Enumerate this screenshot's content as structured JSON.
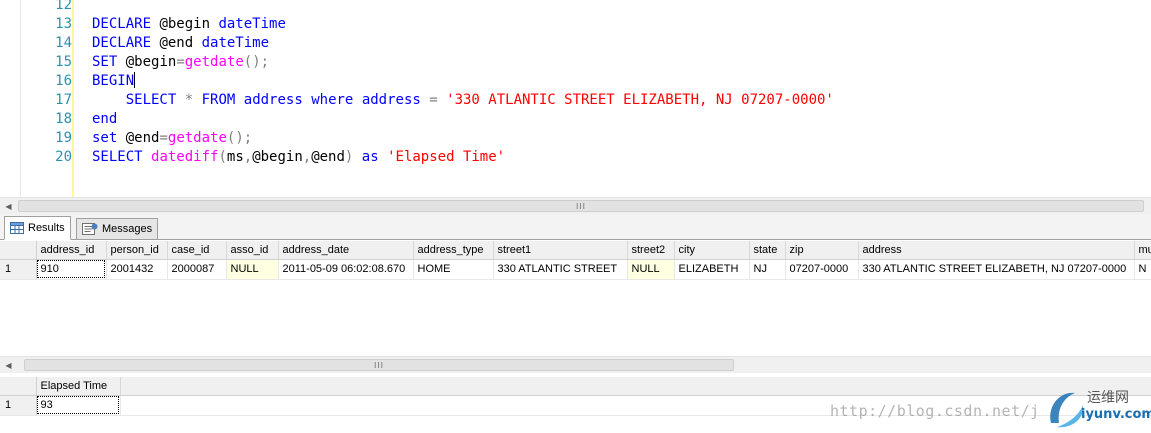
{
  "editor": {
    "line_numbers": [
      "12",
      "13",
      "14",
      "15",
      "16",
      "17",
      "18",
      "19",
      "20"
    ],
    "lines": [
      {
        "n": "12",
        "tokens": []
      },
      {
        "n": "13",
        "tokens": [
          {
            "t": "DECLARE",
            "c": "kw"
          },
          {
            "t": " @begin ",
            "c": "plain"
          },
          {
            "t": "dateTime",
            "c": "kw"
          }
        ]
      },
      {
        "n": "14",
        "tokens": [
          {
            "t": "DECLARE",
            "c": "kw"
          },
          {
            "t": " @end ",
            "c": "plain"
          },
          {
            "t": "dateTime",
            "c": "kw"
          }
        ]
      },
      {
        "n": "15",
        "tokens": [
          {
            "t": "SET",
            "c": "kw"
          },
          {
            "t": " @begin",
            "c": "plain"
          },
          {
            "t": "=",
            "c": "op"
          },
          {
            "t": "getdate",
            "c": "fn"
          },
          {
            "t": "();",
            "c": "op"
          }
        ]
      },
      {
        "n": "16",
        "tokens": [
          {
            "t": "BEGIN",
            "c": "kw"
          }
        ],
        "caret": true
      },
      {
        "n": "17",
        "tokens": [
          {
            "t": "    ",
            "c": "plain"
          },
          {
            "t": "SELECT",
            "c": "kw"
          },
          {
            "t": " ",
            "c": "plain"
          },
          {
            "t": "*",
            "c": "op"
          },
          {
            "t": " ",
            "c": "plain"
          },
          {
            "t": "FROM",
            "c": "kw"
          },
          {
            "t": " ",
            "c": "plain"
          },
          {
            "t": "address",
            "c": "kw"
          },
          {
            "t": " ",
            "c": "plain"
          },
          {
            "t": "where",
            "c": "kw"
          },
          {
            "t": " ",
            "c": "plain"
          },
          {
            "t": "address",
            "c": "kw"
          },
          {
            "t": " ",
            "c": "plain"
          },
          {
            "t": "=",
            "c": "op"
          },
          {
            "t": " ",
            "c": "plain"
          },
          {
            "t": "'330 ATLANTIC STREET ELIZABETH, NJ 07207-0000'",
            "c": "str"
          }
        ]
      },
      {
        "n": "18",
        "tokens": [
          {
            "t": "end",
            "c": "kw"
          }
        ]
      },
      {
        "n": "19",
        "tokens": [
          {
            "t": "set",
            "c": "kw"
          },
          {
            "t": " @end",
            "c": "plain"
          },
          {
            "t": "=",
            "c": "op"
          },
          {
            "t": "getdate",
            "c": "fn"
          },
          {
            "t": "();",
            "c": "op"
          }
        ]
      },
      {
        "n": "20",
        "tokens": [
          {
            "t": "SELECT",
            "c": "kw"
          },
          {
            "t": " ",
            "c": "plain"
          },
          {
            "t": "datediff",
            "c": "fn"
          },
          {
            "t": "(",
            "c": "op"
          },
          {
            "t": "ms",
            "c": "plain"
          },
          {
            "t": ",",
            "c": "op"
          },
          {
            "t": "@begin",
            "c": "plain"
          },
          {
            "t": ",",
            "c": "op"
          },
          {
            "t": "@end",
            "c": "plain"
          },
          {
            "t": ")",
            "c": "op"
          },
          {
            "t": " ",
            "c": "plain"
          },
          {
            "t": "as",
            "c": "kw"
          },
          {
            "t": " ",
            "c": "plain"
          },
          {
            "t": "'Elapsed Time'",
            "c": "str"
          }
        ]
      }
    ]
  },
  "scrollbar_grip": "III",
  "tabs": [
    {
      "label": "Results",
      "icon": "grid-icon",
      "active": true
    },
    {
      "label": "Messages",
      "icon": "messages-icon",
      "active": false
    }
  ],
  "results": {
    "columns": [
      "address_id",
      "person_id",
      "case_id",
      "asso_id",
      "address_date",
      "address_type",
      "street1",
      "street2",
      "city",
      "state",
      "zip",
      "address",
      "mu"
    ],
    "rows": [
      {
        "row_number": "1",
        "cells": [
          "910",
          "2001432",
          "2000087",
          "NULL",
          "2011-05-09 06:02:08.670",
          "HOME",
          "330 ATLANTIC STREET",
          "NULL",
          "ELIZABETH",
          "NJ",
          "07207-0000",
          "330 ATLANTIC STREET ELIZABETH, NJ 07207-0000",
          "N"
        ]
      }
    ]
  },
  "elapsed": {
    "columns": [
      "Elapsed Time"
    ],
    "rows": [
      {
        "row_number": "1",
        "cells": [
          "93"
        ]
      }
    ]
  },
  "watermark": {
    "url": "http://blog.csdn.net/j",
    "logo_cn": "运维网",
    "logo_en": "iyunv.com"
  },
  "colors": {
    "keyword": "#0000ff",
    "function": "#ff00ff",
    "string": "#ff0000",
    "operator": "#808080",
    "line_number": "#2b91af",
    "null_cell": "#ffffe1"
  }
}
